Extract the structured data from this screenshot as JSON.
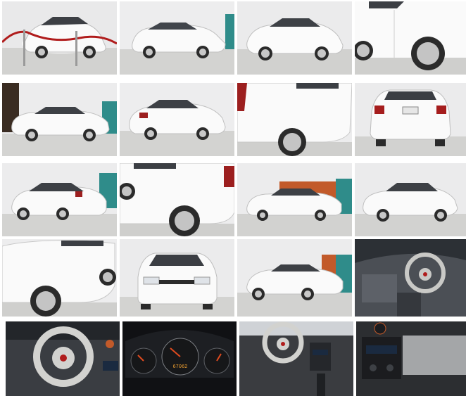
{
  "gallery": {
    "photos": [
      {
        "name": "white-sedan-showroom-rope-barrier-front-three-quarter",
        "color": "#ffffff"
      },
      {
        "name": "white-sedan-front-three-quarter",
        "color": "#ffffff"
      },
      {
        "name": "white-sedan-front-three-quarter-close",
        "color": "#ffffff"
      },
      {
        "name": "white-sedan-side-panel-wheel-close",
        "color": "#ffffff"
      },
      {
        "name": "white-sedan-side-profile",
        "color": "#ffffff"
      },
      {
        "name": "white-sedan-rear-three-quarter",
        "color": "#ffffff"
      },
      {
        "name": "white-sedan-rear-quarter-panel-close",
        "color": "#ffffff"
      },
      {
        "name": "white-sedan-rear-view",
        "color": "#ffffff"
      },
      {
        "name": "white-sedan-rear-three-quarter-left",
        "color": "#ffffff"
      },
      {
        "name": "white-sedan-rear-door-wheel-close",
        "color": "#ffffff"
      },
      {
        "name": "white-sedan-side-profile-wide",
        "color": "#ffffff"
      },
      {
        "name": "white-sedan-front-three-quarter-right",
        "color": "#ffffff"
      },
      {
        "name": "white-sedan-front-door-wheel-close",
        "color": "#ffffff"
      },
      {
        "name": "white-sedan-front-view",
        "color": "#ffffff"
      },
      {
        "name": "white-sedan-side-profile-right",
        "color": "#ffffff"
      },
      {
        "name": "interior-dashboard-steering-wheel",
        "color": "#5a5f66"
      },
      {
        "name": "interior-steering-wheel-close",
        "color": "#c9c9c6"
      },
      {
        "name": "instrument-cluster-gauges",
        "color": "#101114"
      },
      {
        "name": "interior-center-console-steering",
        "color": "#3a3c40"
      },
      {
        "name": "interior-center-stack-radio",
        "color": "#2c2e31"
      }
    ],
    "odometer_text": "67062"
  }
}
